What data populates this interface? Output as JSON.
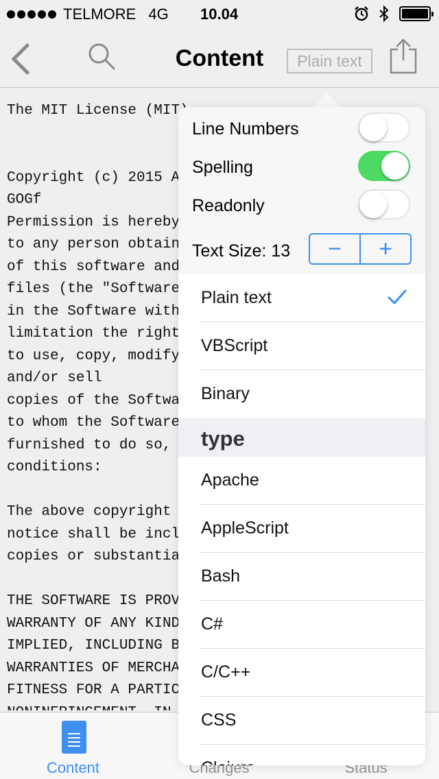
{
  "status_bar": {
    "carrier": "TELMORE",
    "network": "4G",
    "time": "10.04"
  },
  "nav": {
    "title": "Content",
    "mode_label": "Plain text"
  },
  "editor_lines": [
    "The MIT License (MIT)",
    "",
    "",
    "Copyright (c) 2015 A",
    "GOGf",
    "Permission is hereby",
    "to any person obtain",
    "of this software and",
    "files (the \"Software",
    "in the Software with",
    "limitation the right",
    "to use, copy, modify",
    "and/or sell",
    "copies of the Softwa",
    "to whom the Software",
    "furnished to do so,",
    "conditions:",
    "",
    "The above copyright",
    "notice shall be incl",
    "copies or substantia",
    "",
    "THE SOFTWARE IS PROV",
    "WARRANTY OF ANY KIND",
    "IMPLIED, INCLUDING B",
    "WARRANTIES OF MERCHA",
    "FITNESS FOR A PARTIC",
    "NONINFRINGEMENT. IN"
  ],
  "popover": {
    "options": {
      "line_numbers": {
        "label": "Line Numbers",
        "on": false
      },
      "spelling": {
        "label": "Spelling",
        "on": true
      },
      "readonly": {
        "label": "Readonly",
        "on": false
      },
      "text_size_label": "Text Size: 13",
      "minus": "−",
      "plus": "+"
    },
    "modes": [
      {
        "label": "Plain text",
        "selected": true
      },
      {
        "label": "VBScript",
        "selected": false
      },
      {
        "label": "Binary",
        "selected": false
      }
    ],
    "section_title": "type",
    "types": [
      "Apache",
      "AppleScript",
      "Bash",
      "C#",
      "C/C++",
      "CSS",
      "Clojure"
    ]
  },
  "tabs": [
    {
      "label": "Content",
      "active": true
    },
    {
      "label": "Changes",
      "active": false
    },
    {
      "label": "Status",
      "active": false
    }
  ],
  "colors": {
    "accent": "#3d8ff0",
    "switch_on": "#4cd964"
  }
}
